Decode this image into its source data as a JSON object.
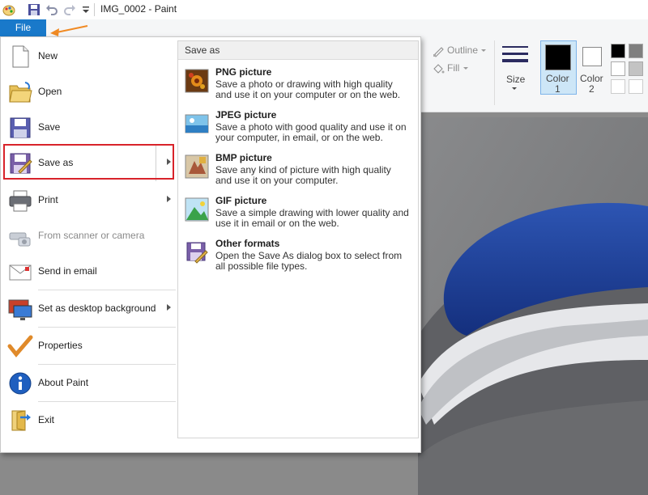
{
  "window": {
    "title": "IMG_0002 - Paint"
  },
  "ribbon": {
    "file_tab": "File",
    "outline_label": "Outline",
    "fill_label": "Fill",
    "size_label": "Size",
    "color1_line1": "Color",
    "color1_line2": "1",
    "color2_line1": "Color",
    "color2_line2": "2"
  },
  "file_menu": {
    "items": [
      {
        "label": "New"
      },
      {
        "label": "Open"
      },
      {
        "label": "Save"
      },
      {
        "label": "Save as"
      },
      {
        "label": "Print"
      },
      {
        "label": "From scanner or camera"
      },
      {
        "label": "Send in email"
      },
      {
        "label": "Set as desktop background"
      },
      {
        "label": "Properties"
      },
      {
        "label": "About Paint"
      },
      {
        "label": "Exit"
      }
    ],
    "submenu": {
      "header": "Save as",
      "items": [
        {
          "title": "PNG picture",
          "desc": "Save a photo or drawing with high quality and use it on your computer or on the web."
        },
        {
          "title": "JPEG picture",
          "desc": "Save a photo with good quality and use it on your computer, in email, or on the web."
        },
        {
          "title": "BMP picture",
          "desc": "Save any kind of picture with high quality and use it on your computer."
        },
        {
          "title": "GIF picture",
          "desc": "Save a simple drawing with lower quality and use it in email or on the web."
        },
        {
          "title": "Other formats",
          "desc": "Open the Save As dialog box to select from all possible file types."
        }
      ]
    }
  },
  "colors": {
    "file_tab": "#1979ca",
    "highlight": "#d8232a",
    "annotation_arrow": "#f08a24",
    "car_seat_blue": "#1c3f9a"
  }
}
